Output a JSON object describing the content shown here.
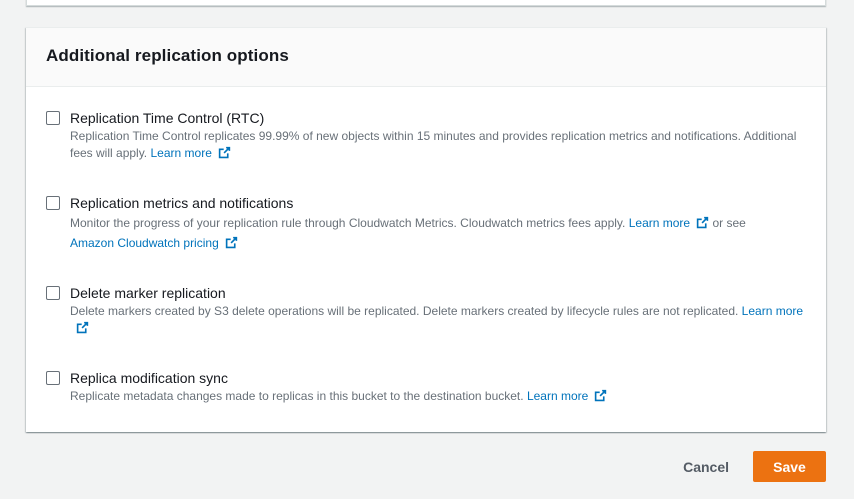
{
  "panel": {
    "title": "Additional replication options"
  },
  "options": [
    {
      "label": "Replication Time Control (RTC)",
      "desc_text": "Replication Time Control replicates 99.99% of new objects within 15 minutes and provides replication metrics and notifications. Additional fees will apply.",
      "link": "Learn more",
      "checked": false
    },
    {
      "label": "Replication metrics and notifications",
      "desc_text": "Monitor the progress of your replication rule through Cloudwatch Metrics. Cloudwatch metrics fees apply.",
      "link": "Learn more",
      "desc_middle": "or see",
      "link2": "Amazon Cloudwatch pricing",
      "checked": false
    },
    {
      "label": "Delete marker replication",
      "desc_text": "Delete markers created by S3 delete operations will be replicated. Delete markers created by lifecycle rules are not replicated.",
      "link": "Learn more",
      "checked": false
    },
    {
      "label": "Replica modification sync",
      "desc_text": "Replicate metadata changes made to replicas in this bucket to the destination bucket.",
      "link": "Learn more",
      "checked": false
    }
  ],
  "actions": {
    "cancel_label": "Cancel",
    "save_label": "Save"
  },
  "icons": {
    "checkbox": "checkbox-unchecked-icon",
    "external": "external-link-icon"
  },
  "colors": {
    "accent": "#ec7211",
    "link": "#0073bb"
  }
}
